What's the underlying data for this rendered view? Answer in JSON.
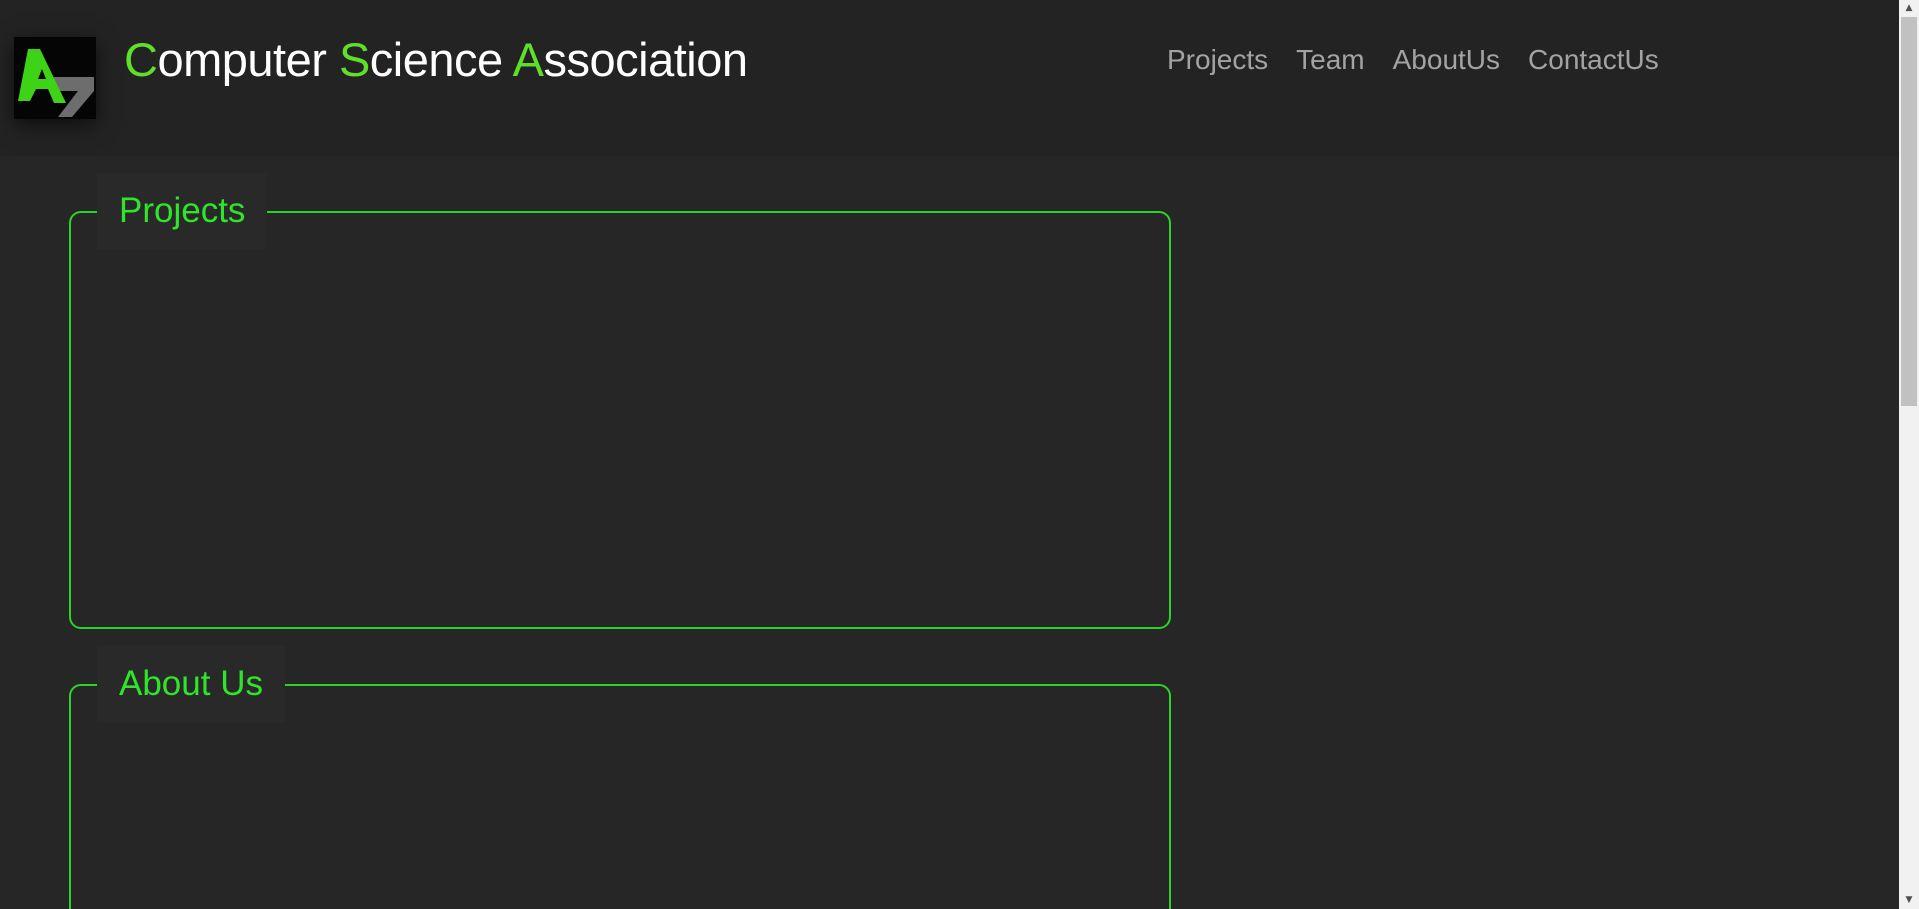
{
  "header": {
    "title_parts": [
      {
        "accent": "C",
        "rest": "omputer "
      },
      {
        "accent": "S",
        "rest": "cience "
      },
      {
        "accent": "A",
        "rest": "ssociation"
      }
    ],
    "logo_icon": "csa-logo-icon"
  },
  "nav": {
    "items": [
      {
        "label": "Projects"
      },
      {
        "label": "Team"
      },
      {
        "label": "AboutUs"
      },
      {
        "label": "ContactUs"
      }
    ]
  },
  "sections": {
    "projects": {
      "title": "Projects"
    },
    "about": {
      "title": "About Us"
    }
  },
  "scrollbar": {
    "up_arrow": "▲",
    "down_arrow": "▼",
    "position_fraction": 0.0
  },
  "colors": {
    "background": "#262626",
    "header_background": "#232323",
    "accent_green": "#5ee02b",
    "section_border": "#2bd426",
    "section_title": "#2ee52a",
    "nav_text": "#a3a3a3"
  }
}
